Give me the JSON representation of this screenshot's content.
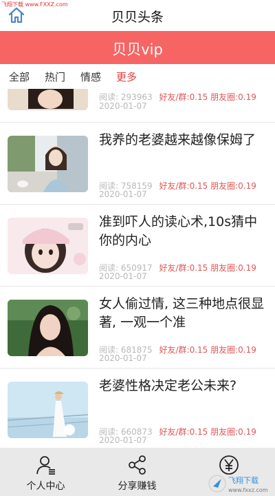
{
  "watermark_top": "飞翔下载 www.FXXZ.com",
  "header": {
    "title": "贝贝头条",
    "home_icon": "home-icon"
  },
  "vip_bar": {
    "title": "贝贝vip",
    "color": "#f76464"
  },
  "tabs": [
    {
      "label": "全部",
      "active": false
    },
    {
      "label": "热门",
      "active": false
    },
    {
      "label": "情感",
      "active": false
    },
    {
      "label": "更多",
      "active": true
    }
  ],
  "articles": [
    {
      "title": "",
      "read_label": "阅读: ",
      "reads": "293963",
      "share": "好友/群:0.15 朋友圈:0.19",
      "date": "2020-01-07"
    },
    {
      "title": "我养的老婆越来越像保姆了",
      "read_label": "阅读: ",
      "reads": "758159",
      "share": "好友/群:0.15 朋友圈:0.19",
      "date": "2020-01-07"
    },
    {
      "title": "准到吓人的读心术,10s猜中你的内心",
      "read_label": "阅读: ",
      "reads": "650917",
      "share": "好友/群:0.15 朋友圈:0.19",
      "date": "2020-01-07"
    },
    {
      "title": "女人偷过情, 这三种地点很显著, 一观一个准",
      "read_label": "阅读: ",
      "reads": "681875",
      "share": "好友/群:0.15 朋友圈:0.19",
      "date": "2020-01-07"
    },
    {
      "title": "老婆性格决定老公未来?",
      "read_label": "阅读: ",
      "reads": "660873",
      "share": "好友/群:0.15 朋友圈:0.19",
      "date": "2020-01-07"
    }
  ],
  "bottom_nav": [
    {
      "label": "个人中心",
      "icon": "user-center-icon"
    },
    {
      "label": "分享赚钱",
      "icon": "share-icon"
    },
    {
      "label": "",
      "icon": "yen-icon"
    }
  ],
  "watermark_bottom": {
    "brand": "飞翔下载",
    "url": "www.fxxz.com"
  }
}
